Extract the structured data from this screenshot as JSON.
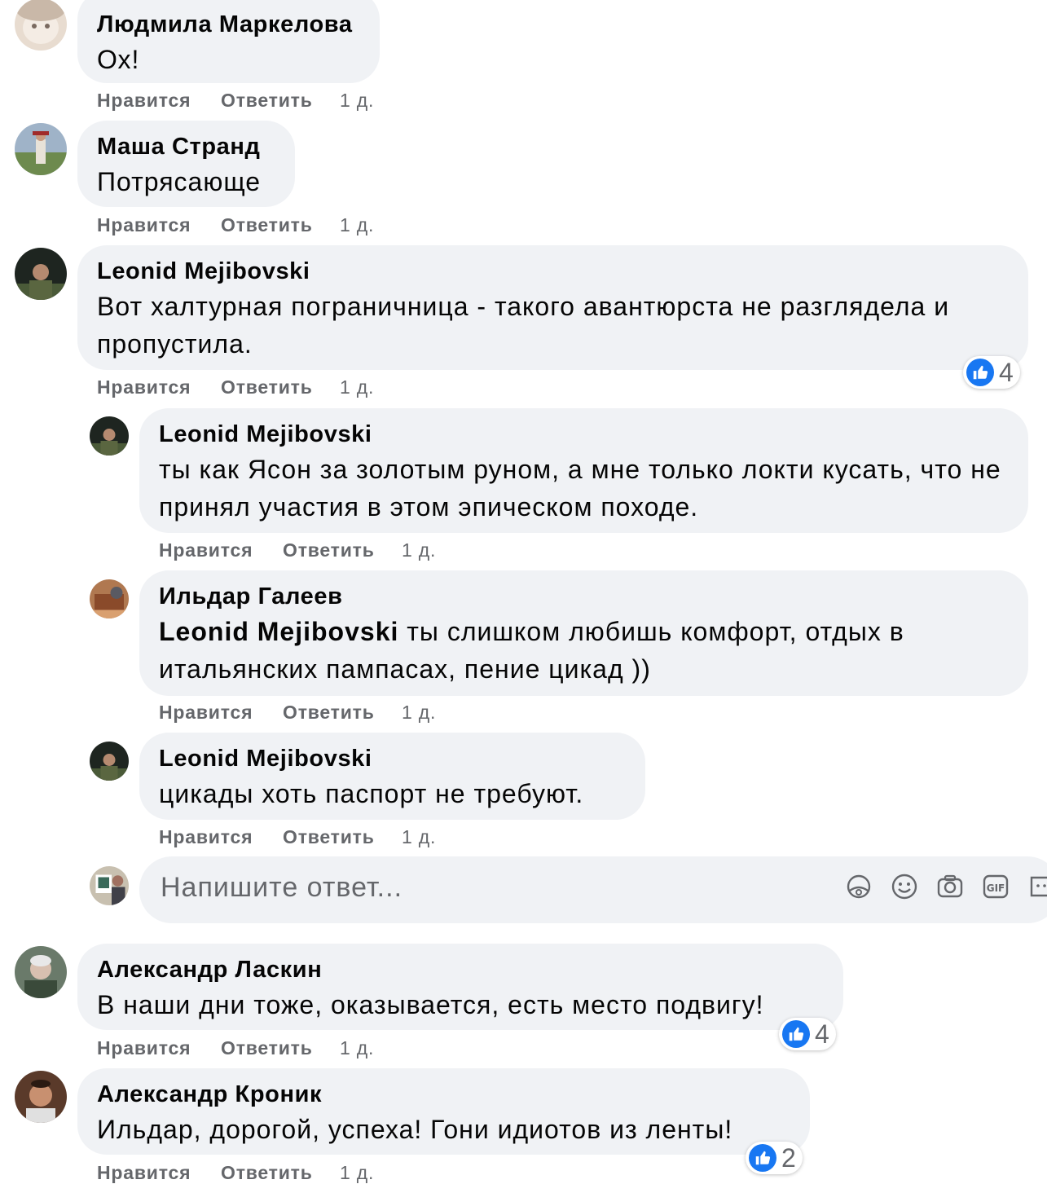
{
  "actions": {
    "like": "Нравится",
    "reply": "Ответить"
  },
  "comments": [
    {
      "author": "Людмила Маркелова",
      "text": "Ох!",
      "time": "1 д."
    },
    {
      "author": "Маша Странд",
      "text": "Потрясающе",
      "time": "1 д."
    },
    {
      "author": "Leonid Mejibovski",
      "text": "Вот халтурная пограничница - такого авантюрста не разглядела и пропустила.",
      "time": "1 д.",
      "reactions": "4"
    },
    {
      "author": "Leonid Mejibovski",
      "text": "ты как Ясон за золотым руном, а мне только локти кусать, что не принял участия в этом эпическом походе.",
      "time": "1 д."
    },
    {
      "author": "Ильдар Галеев",
      "mention": "Leonid Mejibovski",
      "text": " ты слишком любишь комфорт, отдых в итальянских пампасах, пение цикад ))",
      "time": "1 д."
    },
    {
      "author": "Leonid Mejibovski",
      "text": "цикады хоть паспорт не требуют.",
      "time": "1 д."
    },
    {
      "author": "Александр Ласкин",
      "text": "В наши дни тоже, оказывается, есть место подвигу!",
      "time": "1 д.",
      "reactions": "4"
    },
    {
      "author": "Александр Кроник",
      "text": "Ильдар, дорогой, успеха! Гони идиотов из ленты!",
      "time": "1 д.",
      "reactions": "2"
    }
  ],
  "reply_box": {
    "placeholder": "Напишите ответ...",
    "icons": [
      "avatar-sticker-icon",
      "emoji-icon",
      "camera-icon",
      "gif-icon",
      "sticker-icon"
    ]
  },
  "colors": {
    "bubble": "#f0f2f5",
    "meta_text": "#65676b",
    "like_blue": "#1877f2"
  }
}
